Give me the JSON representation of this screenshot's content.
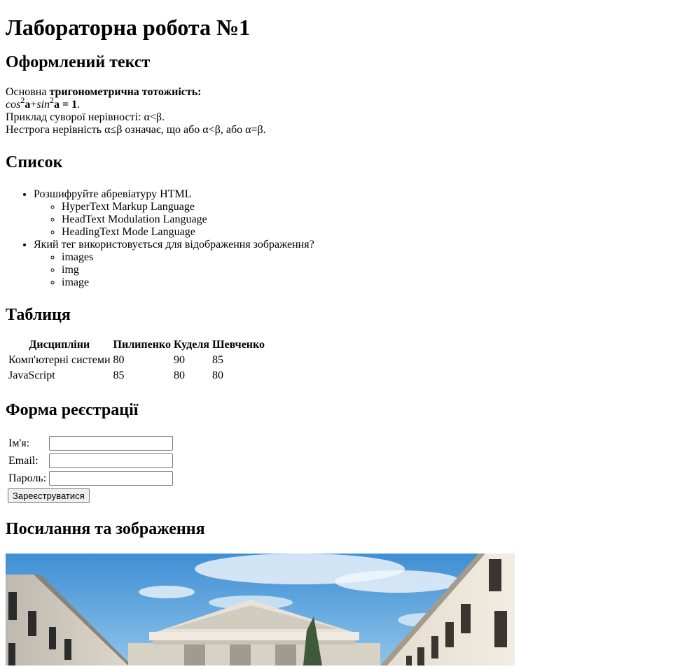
{
  "title": "Лабораторна робота №1",
  "section_text": {
    "heading": "Оформлений текст",
    "line1_plain": "Основна ",
    "line1_bold": "тригонометрична тотожність:",
    "cos": "cos",
    "sup1": "2",
    "alpha1": "a",
    "plus": "+",
    "sin": "sin",
    "sup2": "2",
    "alpha2_eq": "a = 1",
    "dot": ".",
    "line3": "Приклад суворої нерівності: α<β.",
    "line4": "Нестрога нерівність α≤β означає, що або α<β, або α=β."
  },
  "section_list": {
    "heading": "Список",
    "items": [
      {
        "label": "Розшифруйте абревіатуру HTML",
        "sub": [
          "HyperText Markup Language",
          "HeadText Modulation Language",
          "HeadingText Mode Language"
        ]
      },
      {
        "label": "Який тег використовується для відображення зображення?",
        "sub": [
          "images",
          "img",
          "image"
        ]
      }
    ]
  },
  "section_table": {
    "heading": "Таблиця",
    "columns": [
      "Дисципліни",
      "Пилипенко",
      "Куделя",
      "Шевченко"
    ],
    "rows": [
      [
        "Комп'ютерні системи",
        "80",
        "90",
        "85"
      ],
      [
        "JavaScript",
        "85",
        "80",
        "80"
      ]
    ]
  },
  "section_form": {
    "heading": "Форма реєстрації",
    "name_label": "Ім'я:",
    "email_label": "Email:",
    "password_label": "Пароль:",
    "name_value": "",
    "email_value": "",
    "password_value": "",
    "submit_label": "Зареєструватися"
  },
  "section_links": {
    "heading": "Посилання та зображення"
  }
}
